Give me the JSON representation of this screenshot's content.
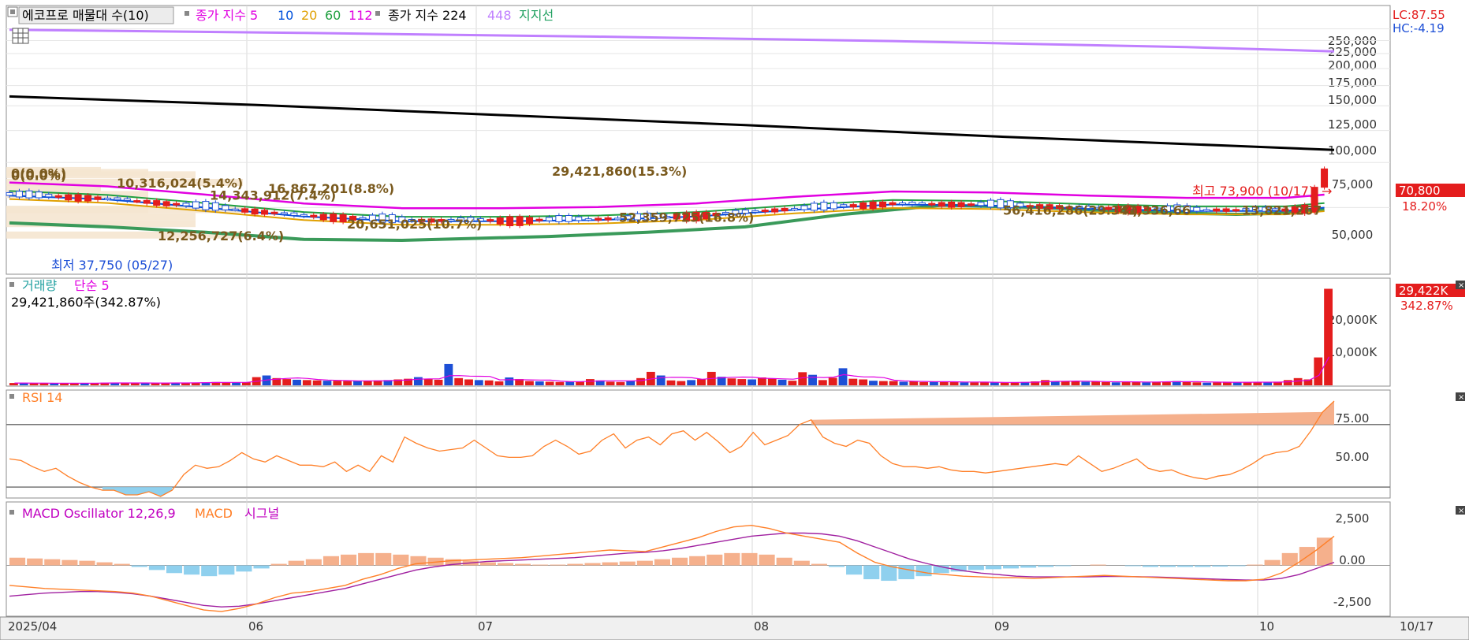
{
  "legend": {
    "main": [
      {
        "text": "에코프로 매물대 수(10)",
        "color": "#000000",
        "boxed": true
      },
      {
        "text": "종가 지수 5",
        "color": "#e100e1"
      },
      {
        "text": "10",
        "color": "#0050dc"
      },
      {
        "text": "20",
        "color": "#e0a000"
      },
      {
        "text": "60",
        "color": "#20a040"
      },
      {
        "text": "112",
        "color": "#e100e1"
      },
      {
        "text": "종가 지수 224",
        "color": "#000000"
      },
      {
        "text": "448",
        "color": "#c080ff"
      },
      {
        "text": "지지선",
        "color": "#20a060"
      }
    ],
    "volume": [
      {
        "text": "거래량",
        "color": "#20a0a0"
      },
      {
        "text": "단순 5",
        "color": "#e100e1"
      }
    ],
    "volume_info": "29,421,860주(342.87%)",
    "rsi": [
      {
        "text": "RSI 14",
        "color": "#ff7f27"
      }
    ],
    "macd": [
      {
        "text": "MACD Oscillator 12,26,9",
        "color": "#c000c0"
      },
      {
        "text": "MACD",
        "color": "#ff7f27"
      },
      {
        "text": "시그널",
        "color": "#c000c0"
      }
    ]
  },
  "right_info": {
    "lc": "LC:87.55",
    "hc": "HC:-4.19",
    "price_tag": "70,800",
    "price_pct": "18.20%",
    "volume_tag": "29,422K",
    "volume_pct": "342.87%"
  },
  "colors": {
    "up": "#e41d1d",
    "down": "#1d4fd6",
    "ema5": "#e100e1",
    "ema10": "#0050dc",
    "ema20": "#e0a000",
    "ema60": "#20a040",
    "ema112": "#e100e1",
    "ema224": "#000000",
    "ema448": "#c080ff",
    "support": "#3a9a5a",
    "rsi": "#ff7f27",
    "macd": "#ff7f27",
    "signal": "#a020a0",
    "osc_pos": "#f5b08c",
    "osc_neg": "#8fd0ee",
    "annotation": "#7a5a1e"
  },
  "chart_data": [
    {
      "type": "candlestick",
      "name": "price",
      "x_axis_labels": [
        "2025/04",
        "06",
        "07",
        "08",
        "09",
        "10",
        "10/17"
      ],
      "y_ticks": [
        "250,000",
        "225,000",
        "200,000",
        "175,000",
        "150,000",
        "125,000",
        "100,000",
        "75,000",
        "50,000"
      ],
      "ylim": [
        28000,
        262000
      ],
      "last_close": 70800,
      "change_pct": "18.20%",
      "high_annotation": "최고 73,900 (10/17)",
      "low_annotation": "최저 37,750 (05/27)",
      "volume_profile_labels": [
        {
          "text": "29,421,860(15.3%)",
          "price": 69000
        },
        {
          "text": "0(0.0%)",
          "price": 67800
        },
        {
          "text": "0(0.0%)",
          "price": 66400
        },
        {
          "text": "10,316,024(5.4%)",
          "price": 62000
        },
        {
          "text": "16,867,201(8.8%)",
          "price": 59000
        },
        {
          "text": "14,343,912(7.4%)",
          "price": 55600
        },
        {
          "text": "52,359,725(16.8%)",
          "price": 45600
        },
        {
          "text": "56,416,286(29.3%)",
          "price": 48600
        },
        {
          "text": "41,336,66",
          "price": 48600
        },
        {
          "text": "13,821,267",
          "price": 48600
        },
        {
          "text": "20,651,025(10.7%)",
          "price": 42800
        },
        {
          "text": "12,256,727(6.4%)",
          "price": 38600
        }
      ],
      "ema224": [
        {
          "x": 0,
          "y": 136000
        },
        {
          "x": 25,
          "y": 126000
        },
        {
          "x": 50,
          "y": 115000
        },
        {
          "x": 75,
          "y": 105000
        },
        {
          "x": 100,
          "y": 95000
        },
        {
          "x": 125,
          "y": 87000
        },
        {
          "x": 135,
          "y": 84000
        }
      ],
      "ema448": [
        {
          "x": 0,
          "y": 248000
        },
        {
          "x": 30,
          "y": 241000
        },
        {
          "x": 60,
          "y": 233000
        },
        {
          "x": 90,
          "y": 224000
        },
        {
          "x": 120,
          "y": 212000
        },
        {
          "x": 135,
          "y": 204000
        }
      ],
      "support": [
        {
          "x": 0,
          "y": 43500
        },
        {
          "x": 10,
          "y": 42000
        },
        {
          "x": 20,
          "y": 40000
        },
        {
          "x": 30,
          "y": 37500
        },
        {
          "x": 40,
          "y": 37200
        },
        {
          "x": 55,
          "y": 38500
        },
        {
          "x": 65,
          "y": 40000
        },
        {
          "x": 75,
          "y": 42000
        },
        {
          "x": 85,
          "y": 47000
        },
        {
          "x": 95,
          "y": 51000
        },
        {
          "x": 105,
          "y": 50000
        },
        {
          "x": 115,
          "y": 48000
        },
        {
          "x": 125,
          "y": 47000
        },
        {
          "x": 130,
          "y": 47500
        },
        {
          "x": 134,
          "y": 49000
        }
      ],
      "ema60": [
        {
          "x": 0,
          "y": 58000
        },
        {
          "x": 10,
          "y": 56000
        },
        {
          "x": 20,
          "y": 52000
        },
        {
          "x": 30,
          "y": 48000
        },
        {
          "x": 40,
          "y": 46000
        },
        {
          "x": 50,
          "y": 46000
        },
        {
          "x": 60,
          "y": 46500
        },
        {
          "x": 70,
          "y": 48000
        },
        {
          "x": 80,
          "y": 51000
        },
        {
          "x": 90,
          "y": 53500
        },
        {
          "x": 100,
          "y": 53000
        },
        {
          "x": 110,
          "y": 51500
        },
        {
          "x": 120,
          "y": 50500
        },
        {
          "x": 130,
          "y": 50500
        },
        {
          "x": 134,
          "y": 52000
        }
      ]
    },
    {
      "type": "bar",
      "name": "volume",
      "y_ticks": [
        "20,000K",
        "10,000K"
      ],
      "ylim": [
        0,
        30500
      ],
      "last_value_k": 29422,
      "values_k": [
        700,
        700,
        650,
        650,
        600,
        700,
        700,
        650,
        650,
        800,
        750,
        700,
        700,
        650,
        650,
        800,
        750,
        800,
        850,
        900,
        1000,
        900,
        850,
        950,
        2500,
        3000,
        2200,
        1900,
        1700,
        1600,
        1500,
        1400,
        1400,
        1300,
        1300,
        1400,
        1500,
        1600,
        1800,
        2000,
        2500,
        1900,
        1700,
        6500,
        2200,
        1800,
        1600,
        1500,
        1200,
        2400,
        1900,
        1300,
        1200,
        1100,
        1000,
        1100,
        1200,
        1900,
        1500,
        1100,
        1000,
        1400,
        2200,
        4100,
        3000,
        1500,
        1300,
        1600,
        1900,
        4100,
        2600,
        2100,
        1900,
        1800,
        2400,
        2100,
        1700,
        1400,
        4000,
        3200,
        1600,
        2300,
        5200,
        2000,
        1800,
        1400,
        1300,
        1300,
        1100,
        1200,
        1000,
        1100,
        1100,
        1000,
        900,
        900,
        1000,
        900,
        800,
        900,
        1000,
        1200,
        1600,
        1300,
        1200,
        1200,
        1100,
        1200,
        1000,
        900,
        1200,
        1000,
        900,
        1100,
        1200,
        1300,
        1000,
        900,
        800,
        900,
        1100,
        1000,
        900,
        900,
        900,
        1100,
        1600,
        2200,
        1800,
        8500,
        29422
      ]
    },
    {
      "type": "line",
      "name": "RSI 14",
      "y_ticks": [
        "75.00",
        "50.00"
      ],
      "ylim": [
        24,
        87
      ],
      "reference_lines": [
        70,
        30
      ],
      "values": [
        48,
        47,
        43,
        40,
        42,
        37,
        33,
        30,
        28,
        28,
        25,
        25,
        27,
        24,
        28,
        38,
        44,
        42,
        43,
        47,
        52,
        48,
        46,
        50,
        47,
        44,
        44,
        43,
        46,
        40,
        44,
        40,
        50,
        46,
        62,
        58,
        55,
        53,
        54,
        55,
        60,
        55,
        50,
        49,
        49,
        50,
        56,
        60,
        56,
        51,
        53,
        60,
        64,
        55,
        60,
        62,
        57,
        64,
        66,
        60,
        65,
        59,
        52,
        56,
        65,
        57,
        60,
        63,
        70,
        73,
        62,
        58,
        56,
        60,
        58,
        50,
        45,
        43,
        43,
        42,
        43,
        41,
        40,
        40,
        39,
        40,
        41,
        42,
        43,
        44,
        45,
        44,
        50,
        45,
        40,
        42,
        45,
        48,
        42,
        40,
        41,
        38,
        36,
        35,
        37,
        38,
        41,
        45,
        50,
        52,
        53,
        56,
        66,
        78,
        85
      ]
    },
    {
      "type": "line",
      "name": "MACD Oscillator 12,26,9",
      "y_ticks": [
        "2,500",
        "0.00",
        "-2,500"
      ],
      "ylim": [
        -3200,
        3200
      ],
      "macd": [
        -1300,
        -1400,
        -1500,
        -1550,
        -1600,
        -1650,
        -1700,
        -1800,
        -2000,
        -2300,
        -2600,
        -2900,
        -3000,
        -2800,
        -2500,
        -2100,
        -1800,
        -1700,
        -1500,
        -1300,
        -900,
        -600,
        -200,
        100,
        200,
        300,
        350,
        400,
        450,
        500,
        600,
        700,
        800,
        900,
        1000,
        950,
        900,
        1200,
        1500,
        1800,
        2200,
        2500,
        2600,
        2400,
        2100,
        1900,
        1700,
        1500,
        800,
        200,
        -100,
        -300,
        -500,
        -600,
        -700,
        -750,
        -800,
        -800,
        -850,
        -800,
        -750,
        -700,
        -650,
        -700,
        -750,
        -800,
        -850,
        -900,
        -950,
        -1000,
        -1000,
        -900,
        -500,
        200,
        1000,
        1900
      ],
      "signal": [
        -2000,
        -1900,
        -1800,
        -1750,
        -1700,
        -1700,
        -1750,
        -1850,
        -2000,
        -2200,
        -2400,
        -2600,
        -2700,
        -2650,
        -2500,
        -2300,
        -2100,
        -1900,
        -1700,
        -1500,
        -1200,
        -900,
        -600,
        -300,
        -100,
        50,
        150,
        250,
        300,
        350,
        400,
        450,
        500,
        600,
        700,
        800,
        850,
        950,
        1100,
        1300,
        1500,
        1700,
        1900,
        2000,
        2100,
        2100,
        2050,
        1900,
        1600,
        1200,
        800,
        400,
        100,
        -150,
        -350,
        -500,
        -600,
        -700,
        -750,
        -750,
        -750,
        -740,
        -720,
        -720,
        -740,
        -760,
        -800,
        -840,
        -880,
        -920,
        -950,
        -950,
        -850,
        -600,
        -200,
        200
      ],
      "oscillator": [
        500,
        450,
        400,
        350,
        300,
        200,
        100,
        -100,
        -300,
        -500,
        -600,
        -700,
        -600,
        -400,
        -200,
        100,
        300,
        400,
        600,
        700,
        800,
        800,
        700,
        600,
        500,
        400,
        300,
        200,
        150,
        100,
        50,
        50,
        100,
        150,
        200,
        250,
        300,
        400,
        500,
        600,
        700,
        800,
        800,
        700,
        500,
        300,
        100,
        -100,
        -600,
        -900,
        -1000,
        -900,
        -700,
        -500,
        -400,
        -300,
        -250,
        -200,
        -150,
        -100,
        -50,
        0,
        50,
        0,
        -50,
        -100,
        -100,
        -100,
        -100,
        -80,
        -50,
        50,
        350,
        800,
        1200,
        1800
      ]
    }
  ]
}
